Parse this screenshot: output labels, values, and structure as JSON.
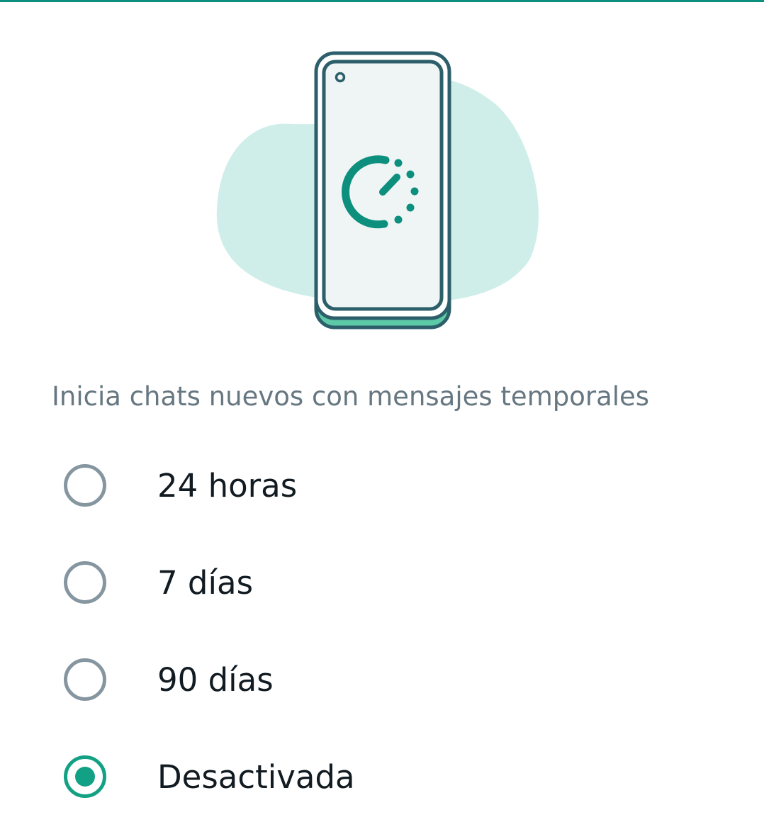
{
  "colors": {
    "accent": "#12a184",
    "radio_unchecked": "#8696a0",
    "heading_text": "#667781",
    "label_text": "#111b21",
    "blob": "#cfeee9",
    "phone_outline": "#2d5f6b"
  },
  "illustration": {
    "icon": "timer-phone-icon"
  },
  "section": {
    "heading": "Inicia chats nuevos con mensajes temporales"
  },
  "options": [
    {
      "label": "24 horas",
      "checked": false
    },
    {
      "label": "7 días",
      "checked": false
    },
    {
      "label": "90 días",
      "checked": false
    },
    {
      "label": "Desactivada",
      "checked": true
    }
  ]
}
